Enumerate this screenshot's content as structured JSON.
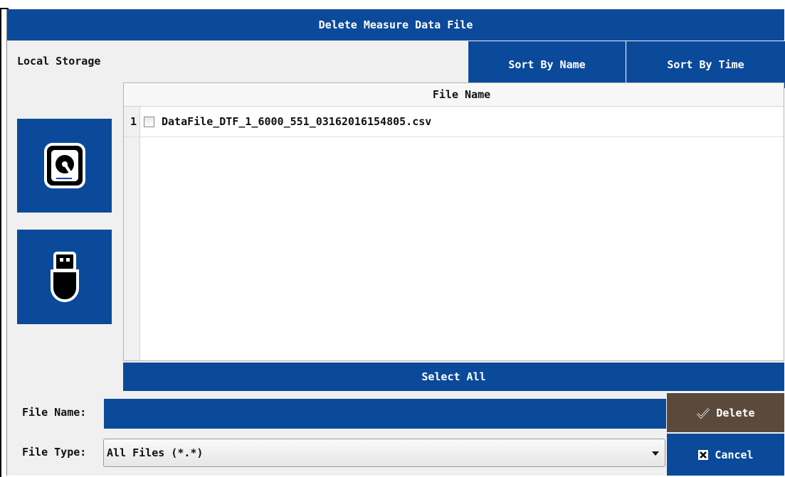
{
  "dialog": {
    "title": "Delete Measure Data File"
  },
  "storage": {
    "label": "Local Storage",
    "devices": [
      {
        "name": "local-storage",
        "icon": "disk-icon"
      },
      {
        "name": "usb-storage",
        "icon": "usb-drive-icon"
      }
    ]
  },
  "sort": {
    "by_name": "Sort By Name",
    "by_time": "Sort By Time"
  },
  "table": {
    "header": "File Name",
    "rows": [
      {
        "index": "1",
        "name": "DataFile_DTF_1_6000_551_03162016154805.csv",
        "checked": false
      }
    ]
  },
  "select_all": "Select All",
  "file_name": {
    "label": "File Name:",
    "value": ""
  },
  "file_type": {
    "label": "File Type:",
    "selected": "All Files (*.*)"
  },
  "actions": {
    "delete": "Delete",
    "cancel": "Cancel"
  },
  "colors": {
    "primary_blue": "#0b4a9a",
    "delete_brown": "#5b4a3c",
    "background": "#f0f0f0"
  }
}
